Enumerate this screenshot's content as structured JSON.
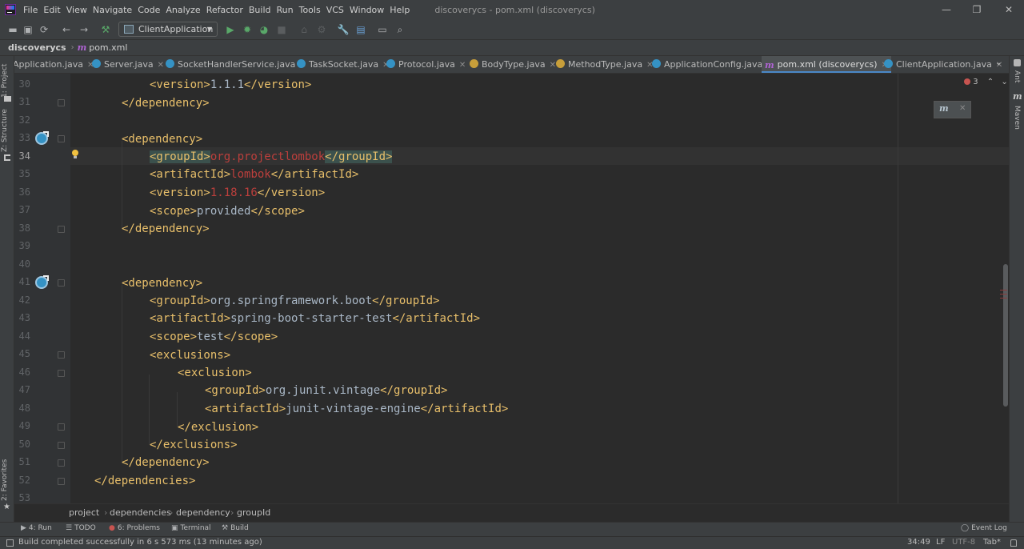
{
  "menu": {
    "items": [
      "File",
      "Edit",
      "View",
      "Navigate",
      "Code",
      "Analyze",
      "Refactor",
      "Build",
      "Run",
      "Tools",
      "VCS",
      "Window",
      "Help"
    ],
    "window_title": "discoverycs - pom.xml (discoverycs)"
  },
  "window_controls": {
    "minimize": "—",
    "restore": "❐",
    "close": "✕"
  },
  "toolbar": {
    "run_config": "ClientApplication",
    "icons": [
      "save-all-icon",
      "sync-icon",
      "back-icon",
      "forward-icon",
      "build-hammer-icon",
      "run-icon",
      "debug-icon",
      "coverage-icon",
      "stop-icon",
      "vcs-icon",
      "settings-icon",
      "project-structure-icon",
      "search-icon"
    ]
  },
  "nav": {
    "project": "discoverycs",
    "file": "pom.xml"
  },
  "left_strip": {
    "project": "1: Project",
    "structure": "Z: Structure",
    "favorites": "2: Favorites"
  },
  "right_strip": {
    "ant": "Ant",
    "maven": "Maven"
  },
  "tabs": [
    {
      "label": "Application.java",
      "kind": "class"
    },
    {
      "label": "Server.java",
      "kind": "class"
    },
    {
      "label": "SocketHandlerService.java",
      "kind": "class"
    },
    {
      "label": "TaskSocket.java",
      "kind": "class"
    },
    {
      "label": "Protocol.java",
      "kind": "class"
    },
    {
      "label": "BodyType.java",
      "kind": "enum"
    },
    {
      "label": "MethodType.java",
      "kind": "enum"
    },
    {
      "label": "ApplicationConfig.java",
      "kind": "class"
    },
    {
      "label": "pom.xml (discoverycs)",
      "kind": "maven",
      "active": true
    },
    {
      "label": "ClientApplication.java",
      "kind": "class"
    }
  ],
  "editor": {
    "error_count": "3",
    "line_numbers": [
      "30",
      "31",
      "32",
      "33",
      "34",
      "35",
      "36",
      "37",
      "38",
      "39",
      "40",
      "41",
      "42",
      "43",
      "44",
      "45",
      "46",
      "47",
      "48",
      "49",
      "50",
      "51",
      "52",
      "53"
    ],
    "current_line": "34"
  },
  "code": {
    "l30_open": "<version>",
    "l30_text": "1.1.1",
    "l30_close": "</version>",
    "l31": "</dependency>",
    "l33": "<dependency>",
    "l34_open": "<groupId>",
    "l34_text": "org.projectlombok",
    "l34_close": "</groupId>",
    "l35_open": "<artifactId>",
    "l35_text": "lombok",
    "l35_close": "</artifactId>",
    "l36_open": "<version>",
    "l36_text": "1.18.16",
    "l36_close": "</version>",
    "l37_open": "<scope>",
    "l37_text": "provided",
    "l37_close": "</scope>",
    "l38": "</dependency>",
    "l41": "<dependency>",
    "l42_open": "<groupId>",
    "l42_text": "org.springframework.boot",
    "l42_close": "</groupId>",
    "l43_open": "<artifactId>",
    "l43_text": "spring-boot-starter-test",
    "l43_close": "</artifactId>",
    "l44_open": "<scope>",
    "l44_text": "test",
    "l44_close": "</scope>",
    "l45": "<exclusions>",
    "l46": "<exclusion>",
    "l47_open": "<groupId>",
    "l47_text": "org.junit.vintage",
    "l47_close": "</groupId>",
    "l48_open": "<artifactId>",
    "l48_text": "junit-vintage-engine",
    "l48_close": "</artifactId>",
    "l49": "</exclusion>",
    "l50": "</exclusions>",
    "l51": "</dependency>",
    "l52": "</dependencies>"
  },
  "code_breadcrumb": [
    "project",
    "dependencies",
    "dependency",
    "groupId"
  ],
  "tool_windows": [
    {
      "label": "4: Run",
      "icon": "run-icon"
    },
    {
      "label": "TODO",
      "icon": "list-icon"
    },
    {
      "label": "6: Problems",
      "icon": "problems-icon"
    },
    {
      "label": "Terminal",
      "icon": "terminal-icon"
    },
    {
      "label": "Build",
      "icon": "hammer-icon"
    }
  ],
  "event_log": "Event Log",
  "status": {
    "message": "Build completed successfully in 6 s 573 ms (13 minutes ago)",
    "position": "34:49",
    "line_sep": "LF",
    "encoding": "UTF-8",
    "indent": "Tab*"
  },
  "colors": {
    "tag": "#e8bf6a",
    "text": "#a9b7c6",
    "unresolved": "#bc3f3c",
    "accent": "#4a88c7"
  }
}
